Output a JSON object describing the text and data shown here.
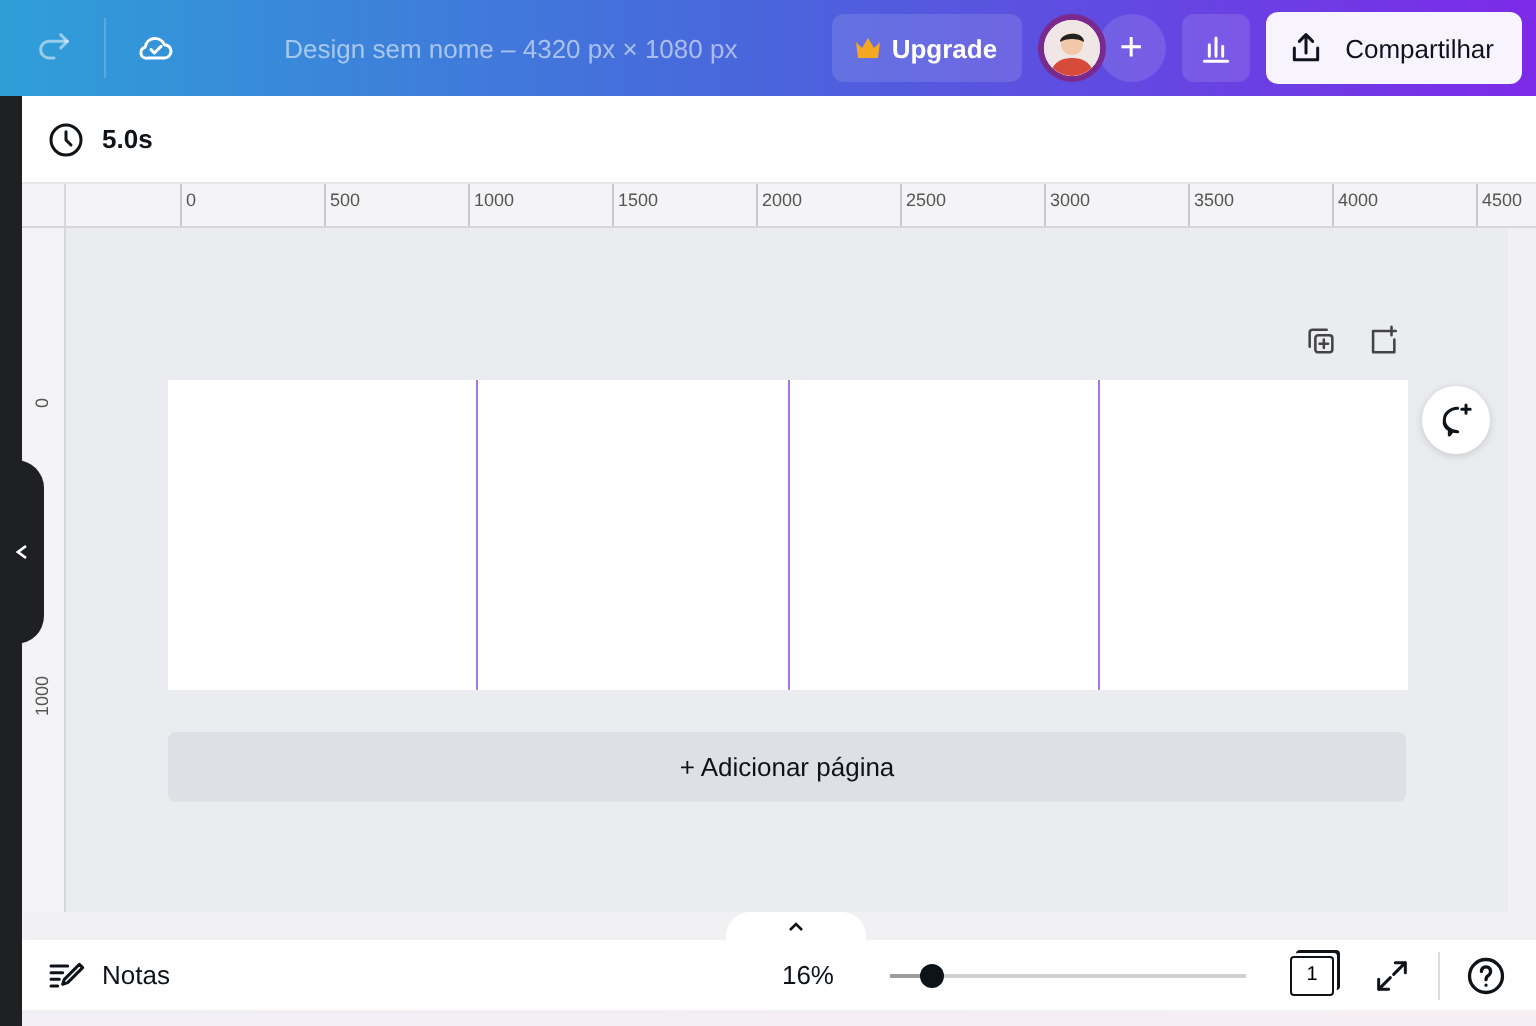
{
  "top_bar": {
    "title": "Design sem nome – 4320 px × 1080 px",
    "upgrade_label": "Upgrade",
    "add_label": "+",
    "share_label": "Compartilhar"
  },
  "toolbar": {
    "duration": "5.0s"
  },
  "rulers": {
    "horizontal": [
      "0",
      "500",
      "1000",
      "1500",
      "2000",
      "2500",
      "3000",
      "3500",
      "4000",
      "4500"
    ],
    "vertical": [
      "0",
      "1000"
    ]
  },
  "canvas": {
    "add_page_label": "+ Adicionar página"
  },
  "bottom_bar": {
    "notes_label": "Notas",
    "zoom": "16%",
    "zoom_slider": {
      "level": 0.12
    },
    "page_count": "1"
  }
}
